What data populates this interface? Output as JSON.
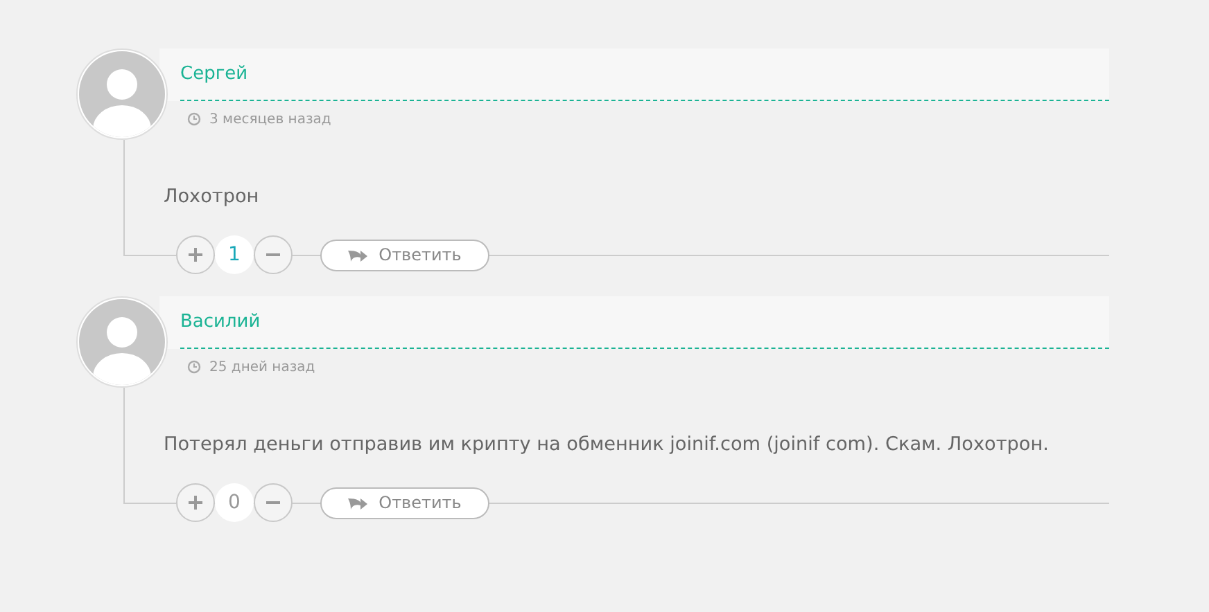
{
  "comments": [
    {
      "author": "Сергей",
      "time": "3 месяцев назад",
      "text": "Лохотрон",
      "score": "1",
      "positive": true,
      "reply": "Ответить"
    },
    {
      "author": "Василий",
      "time": "25 дней назад",
      "text": "Потерял деньги отправив им крипту на обменник joinif.com (joinif com). Скам. Лохотрон.",
      "score": "0",
      "positive": false,
      "reply": "Ответить"
    }
  ]
}
